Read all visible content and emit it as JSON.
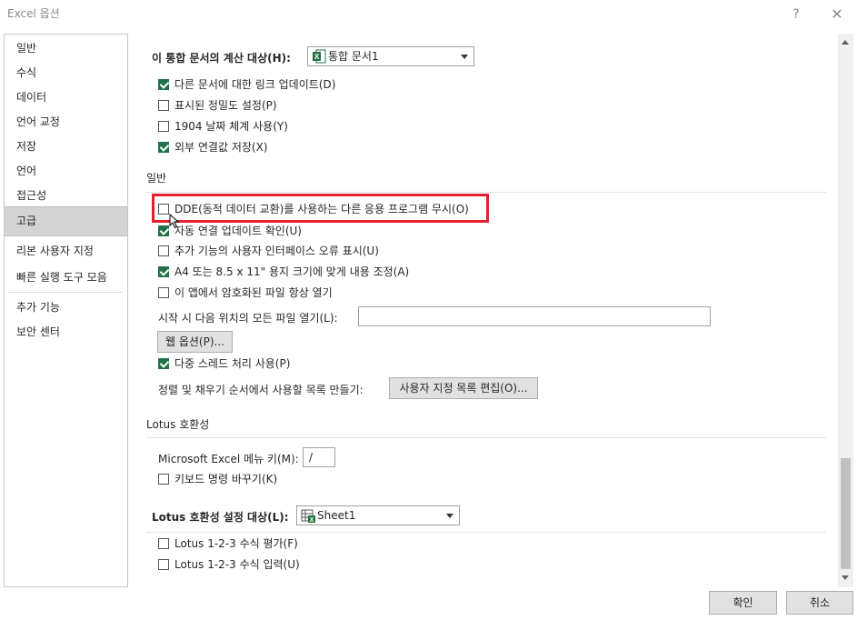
{
  "window": {
    "title": "Excel 옵션",
    "help_label": "?",
    "close_label": "✕"
  },
  "sidebar": {
    "items": [
      {
        "label": "일반"
      },
      {
        "label": "수식"
      },
      {
        "label": "데이터"
      },
      {
        "label": "언어 교정"
      },
      {
        "label": "저장"
      },
      {
        "label": "언어"
      },
      {
        "label": "접근성"
      },
      {
        "label": "고급",
        "selected": true
      },
      {
        "label": "리본 사용자 지정"
      },
      {
        "label": "빠른 실행 도구 모음"
      },
      {
        "label": "추가 기능"
      },
      {
        "label": "보안 센터"
      }
    ]
  },
  "workbook_calc": {
    "label": "이 통합 문서의 계산 대상(H):",
    "dropdown_value": "통합 문서1",
    "options": [
      {
        "label": "다른 문서에 대한 링크 업데이트(D)",
        "checked": true
      },
      {
        "label": "표시된 정밀도 설정(P)",
        "checked": false
      },
      {
        "label": "1904 날짜 체계 사용(Y)",
        "checked": false
      },
      {
        "label": "외부 연결값 저장(X)",
        "checked": true
      }
    ]
  },
  "general": {
    "heading": "일반",
    "options": [
      {
        "label": "DDE(동적 데이터 교환)를 사용하는 다른 응용 프로그램 무시(O)",
        "checked": false
      },
      {
        "label": "자동 연결 업데이트 확인(U)",
        "checked": true
      },
      {
        "label": "추가 기능의 사용자 인터페이스 오류 표시(U)",
        "checked": false
      },
      {
        "label": "A4 또는 8.5 x 11\" 용지 크기에 맞게 내용 조정(A)",
        "checked": true
      },
      {
        "label": "이 앱에서 암호화된 파일 항상 열기",
        "checked": false
      }
    ],
    "startup_label": "시작 시 다음 위치의 모든 파일 열기(L):",
    "startup_value": "",
    "web_options_button": "웹 옵션(P)...",
    "multithread_option": {
      "label": "다중 스레드 처리 사용(P)",
      "checked": true
    },
    "sort_fill_label": "정렬 및 채우기 순서에서 사용할 목록 만들기:",
    "edit_custom_lists_button": "사용자 지정 목록 편집(O)..."
  },
  "lotus_compat": {
    "heading": "Lotus 호환성",
    "menu_key_label": "Microsoft Excel 메뉴 키(M):",
    "menu_key_value": "/",
    "nav_keys_option": {
      "label": "키보드 명령 바꾸기(K)",
      "checked": false
    }
  },
  "lotus_compat_settings": {
    "label": "Lotus 호환성 설정 대상(L):",
    "dropdown_value": "Sheet1",
    "options": [
      {
        "label": "Lotus 1-2-3 수식 평가(F)",
        "checked": false
      },
      {
        "label": "Lotus 1-2-3 수식 입력(U)",
        "checked": false
      }
    ]
  },
  "footer": {
    "ok_label": "확인",
    "cancel_label": "취소"
  },
  "colors": {
    "excel_green": "#217346",
    "highlight_red": "#e5202e",
    "selected_nav_bg": "#d4d4d4"
  },
  "icons": [
    "excel-workbook-icon",
    "excel-sheet-icon",
    "checkbox-check-icon",
    "dropdown-arrow-icon",
    "mouse-cursor-icon"
  ]
}
